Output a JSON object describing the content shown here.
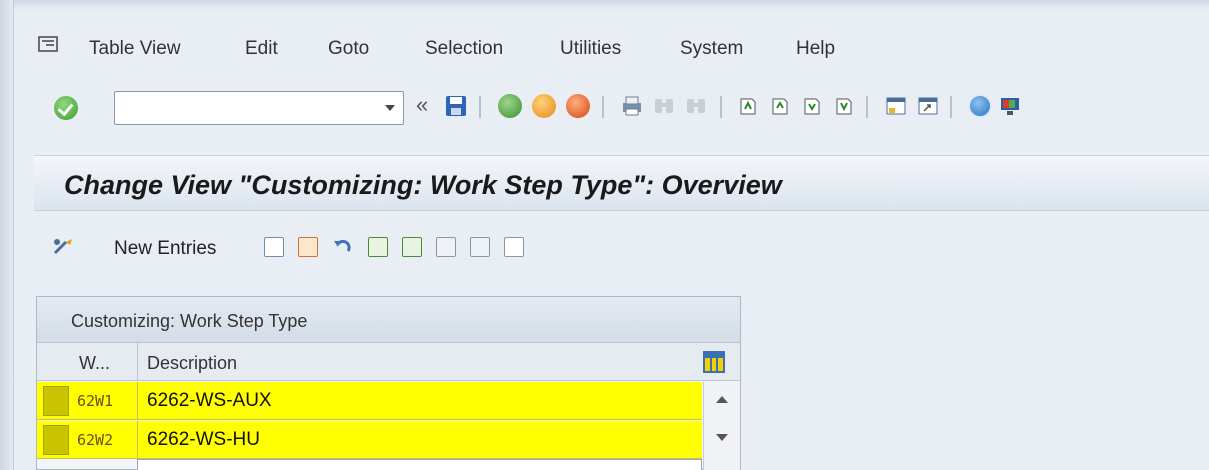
{
  "menu": {
    "items": [
      "Table View",
      "Edit",
      "Goto",
      "Selection",
      "Utilities",
      "System",
      "Help"
    ]
  },
  "toolbar": {
    "command_value": "",
    "back_glyph": "«"
  },
  "title": "Change View \"Customizing: Work Step Type\": Overview",
  "app_toolbar": {
    "new_entries_label": "New Entries"
  },
  "table": {
    "title": "Customizing: Work Step Type",
    "columns": [
      "W...",
      "Description"
    ],
    "rows": [
      {
        "code": "62W1",
        "description": "6262-WS-AUX"
      },
      {
        "code": "62W2",
        "description": "6262-WS-HU"
      }
    ]
  },
  "colors": {
    "row_highlight": "#ffff00",
    "title_bg": "#dbe4ee",
    "accent": "#3b6fb6"
  }
}
